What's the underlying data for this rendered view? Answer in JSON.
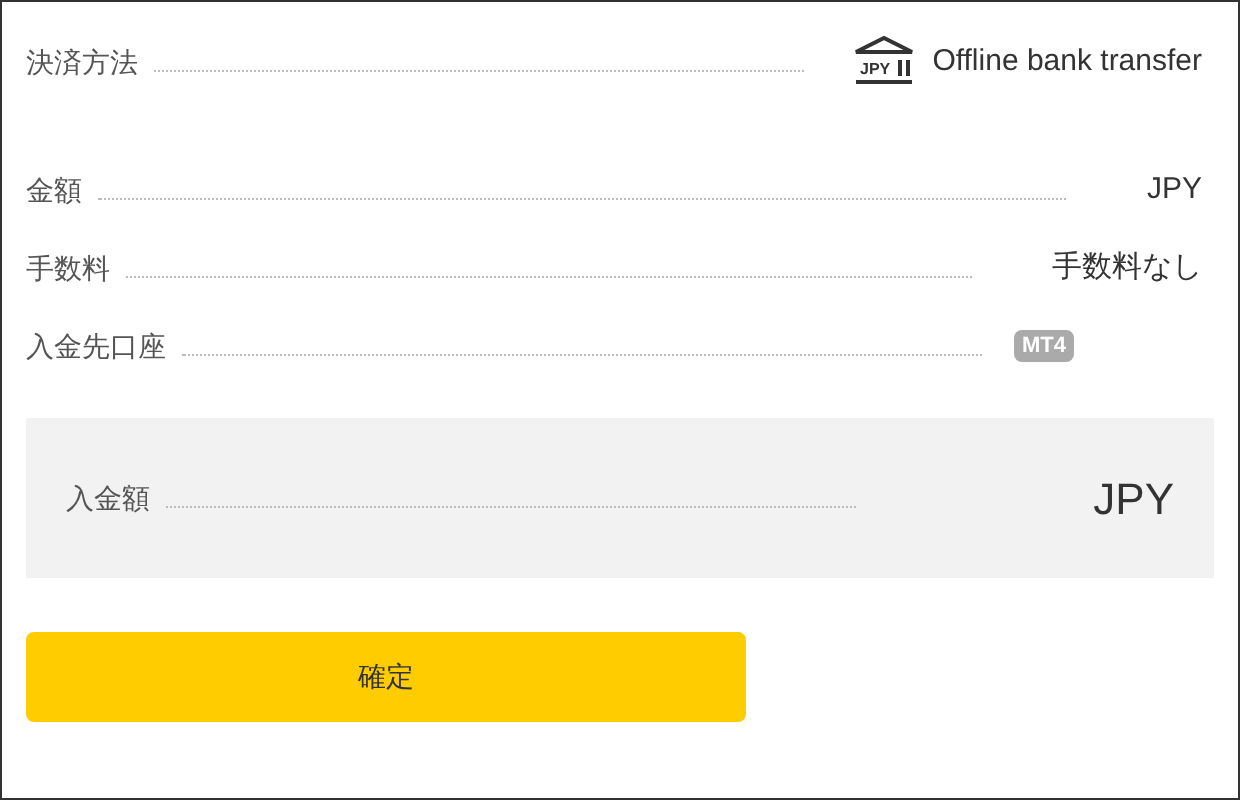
{
  "payment_method": {
    "label": "決済方法",
    "icon_text": "JPY",
    "value": "Offline bank transfer"
  },
  "details": [
    {
      "kind": "text",
      "label": "金額",
      "value": "JPY"
    },
    {
      "kind": "text",
      "label": "手数料",
      "value": "手数料なし"
    },
    {
      "kind": "badge",
      "label": "入金先口座",
      "value": "MT4"
    }
  ],
  "deposit": {
    "label": "入金額",
    "currency": "JPY"
  },
  "confirm_button": "確定"
}
